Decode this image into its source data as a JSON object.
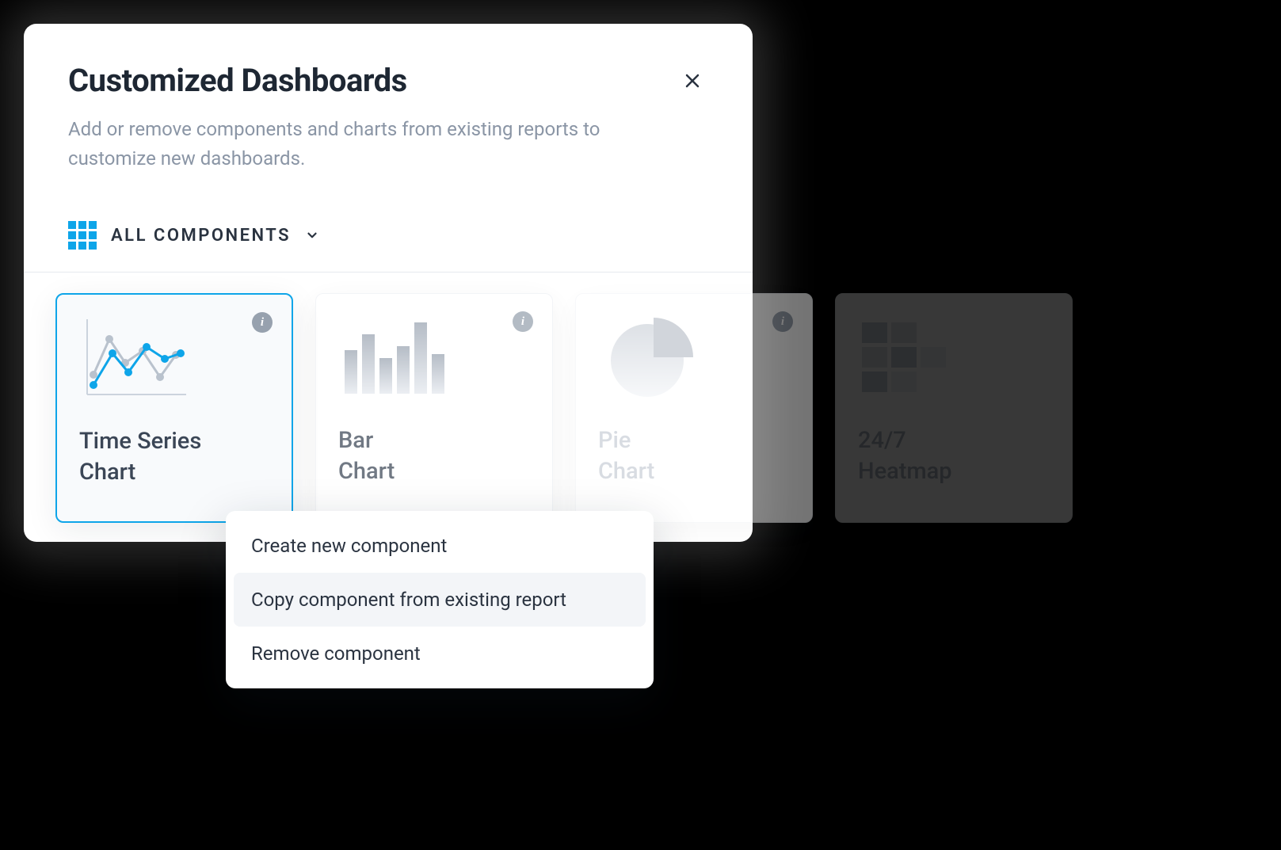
{
  "dialog": {
    "title": "Customized Dashboards",
    "subtitle": "Add or remove components and charts from existing reports to customize new dashboards."
  },
  "filter": {
    "label": "ALL COMPONENTS"
  },
  "cards": {
    "time_series": {
      "line1": "Time Series",
      "line2": "Chart"
    },
    "bar": {
      "line1": "Bar",
      "line2": "Chart"
    },
    "pie": {
      "line1": "Pie",
      "line2": "Chart"
    },
    "heatmap": {
      "line1": "24/7",
      "line2": "Heatmap"
    }
  },
  "menu": {
    "create": "Create new component",
    "copy": "Copy component from existing report",
    "remove": "Remove component"
  }
}
